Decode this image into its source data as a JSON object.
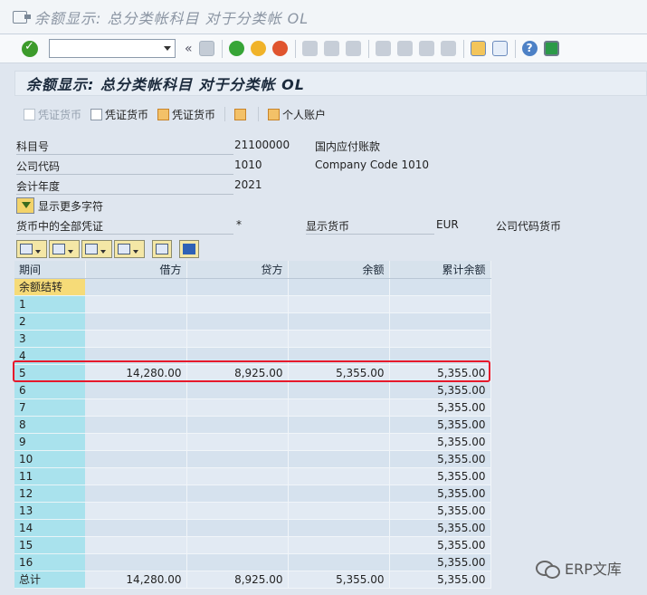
{
  "window": {
    "title": "余额显示: 总分类帐科目 对于分类帐 OL"
  },
  "stdbar": {
    "command_value": ""
  },
  "screen": {
    "title": "余额显示: 总分类帐科目 对于分类帐 OL"
  },
  "appbar": {
    "doc_currency_disabled": "凭证货币",
    "doc_currency_1": "凭证货币",
    "doc_currency_2": "凭证货币",
    "personal_account": "个人账户"
  },
  "header": {
    "account_label": "科目号",
    "account_value": "21100000",
    "account_desc": "国内应付账款",
    "company_label": "公司代码",
    "company_value": "1010",
    "company_desc": "Company Code 1010",
    "year_label": "会计年度",
    "year_value": "2021",
    "more_chars": "显示更多字符",
    "all_docs_label": "货币中的全部凭证",
    "all_docs_value": "*",
    "display_currency_label": "显示货币",
    "display_currency_value": "EUR",
    "company_currency_label": "公司代码货币"
  },
  "grid": {
    "columns": [
      "期间",
      "借方",
      "贷方",
      "余额",
      "累计余额"
    ],
    "rows": [
      [
        "余额结转",
        "",
        "",
        "",
        ""
      ],
      [
        "1",
        "",
        "",
        "",
        ""
      ],
      [
        "2",
        "",
        "",
        "",
        ""
      ],
      [
        "3",
        "",
        "",
        "",
        ""
      ],
      [
        "4",
        "",
        "",
        "",
        ""
      ],
      [
        "5",
        "14,280.00",
        "8,925.00",
        "5,355.00",
        "5,355.00"
      ],
      [
        "6",
        "",
        "",
        "",
        "5,355.00"
      ],
      [
        "7",
        "",
        "",
        "",
        "5,355.00"
      ],
      [
        "8",
        "",
        "",
        "",
        "5,355.00"
      ],
      [
        "9",
        "",
        "",
        "",
        "5,355.00"
      ],
      [
        "10",
        "",
        "",
        "",
        "5,355.00"
      ],
      [
        "11",
        "",
        "",
        "",
        "5,355.00"
      ],
      [
        "12",
        "",
        "",
        "",
        "5,355.00"
      ],
      [
        "13",
        "",
        "",
        "",
        "5,355.00"
      ],
      [
        "14",
        "",
        "",
        "",
        "5,355.00"
      ],
      [
        "15",
        "",
        "",
        "",
        "5,355.00"
      ],
      [
        "16",
        "",
        "",
        "",
        "5,355.00"
      ],
      [
        "总计",
        "14,280.00",
        "8,925.00",
        "5,355.00",
        "5,355.00"
      ]
    ]
  },
  "watermark": {
    "text": "ERP文库"
  }
}
